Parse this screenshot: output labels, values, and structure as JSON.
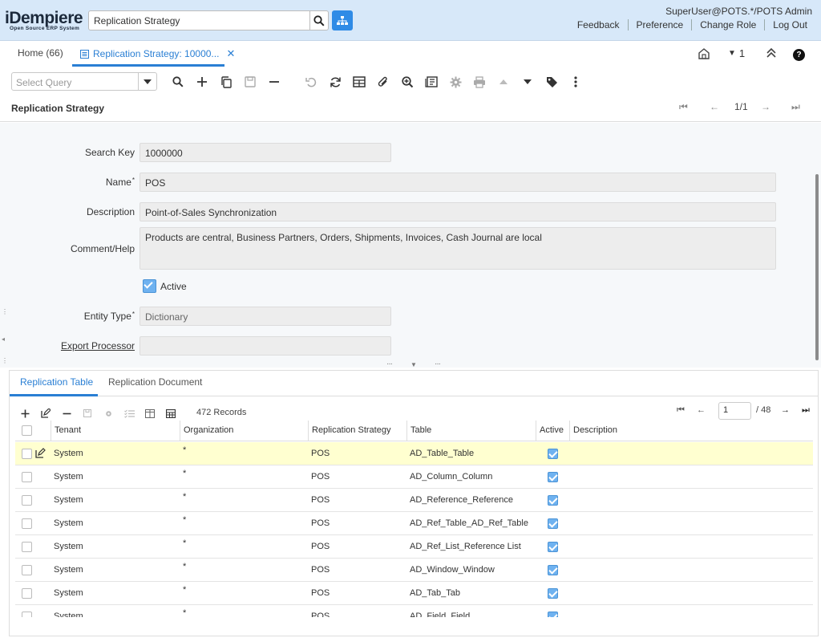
{
  "header": {
    "logo_word": "iDempiere",
    "logo_tag": "Open Source ERP System",
    "search_value": "Replication Strategy",
    "user": "SuperUser@POTS.*/POTS Admin",
    "links": [
      "Feedback",
      "Preference",
      "Change Role",
      "Log Out"
    ]
  },
  "tabs": {
    "home": "Home (66)",
    "current": "Replication Strategy: 10000...",
    "right_count": "1"
  },
  "toolbar": {
    "query_placeholder": "Select Query"
  },
  "window": {
    "title": "Replication Strategy",
    "record_nav": "1/1"
  },
  "form": {
    "search_key_label": "Search Key",
    "search_key_value": "1000000",
    "name_label": "Name",
    "name_value": "POS",
    "description_label": "Description",
    "description_value": "Point-of-Sales Synchronization",
    "comment_label": "Comment/Help",
    "comment_value": "Products are central, Business Partners, Orders, Shipments, Invoices, Cash Journal are local",
    "active_label": "Active",
    "active_checked": true,
    "entity_type_label": "Entity Type",
    "entity_type_value": "Dictionary",
    "export_processor_label": "Export Processor",
    "export_processor_value": ""
  },
  "detail": {
    "tabs": [
      "Replication Table",
      "Replication Document"
    ],
    "records": "472 Records",
    "page_value": "1",
    "page_total": "/ 48",
    "columns": [
      "Tenant",
      "Organization",
      "Replication Strategy",
      "Table",
      "Active",
      "Description"
    ],
    "rows": [
      {
        "tenant": "System",
        "org": "*",
        "strategy": "POS",
        "table": "AD_Table_Table",
        "active": true
      },
      {
        "tenant": "System",
        "org": "*",
        "strategy": "POS",
        "table": "AD_Column_Column",
        "active": true
      },
      {
        "tenant": "System",
        "org": "*",
        "strategy": "POS",
        "table": "AD_Reference_Reference",
        "active": true
      },
      {
        "tenant": "System",
        "org": "*",
        "strategy": "POS",
        "table": "AD_Ref_Table_AD_Ref_Table",
        "active": true
      },
      {
        "tenant": "System",
        "org": "*",
        "strategy": "POS",
        "table": "AD_Ref_List_Reference List",
        "active": true
      },
      {
        "tenant": "System",
        "org": "*",
        "strategy": "POS",
        "table": "AD_Window_Window",
        "active": true
      },
      {
        "tenant": "System",
        "org": "*",
        "strategy": "POS",
        "table": "AD_Tab_Tab",
        "active": true
      },
      {
        "tenant": "System",
        "org": "*",
        "strategy": "POS",
        "table": "AD_Field_Field",
        "active": true
      }
    ]
  },
  "colors": {
    "header_bg": "#d7e8f9",
    "accent": "#2a7fd4",
    "selected_row": "#ffffd0"
  }
}
